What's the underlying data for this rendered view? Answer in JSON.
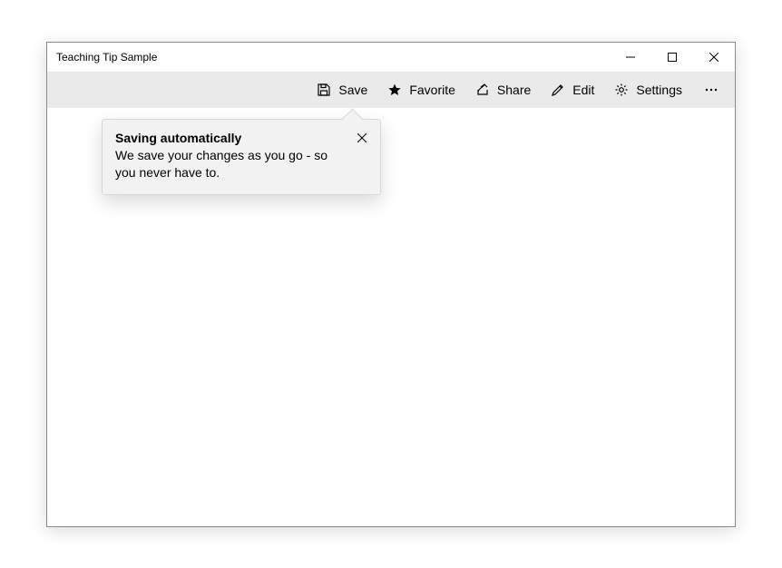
{
  "window": {
    "title": "Teaching Tip Sample"
  },
  "commandbar": {
    "save_label": "Save",
    "favorite_label": "Favorite",
    "share_label": "Share",
    "edit_label": "Edit",
    "settings_label": "Settings"
  },
  "teaching_tip": {
    "title": "Saving automatically",
    "body": "We save your changes as you go - so you never have to."
  }
}
